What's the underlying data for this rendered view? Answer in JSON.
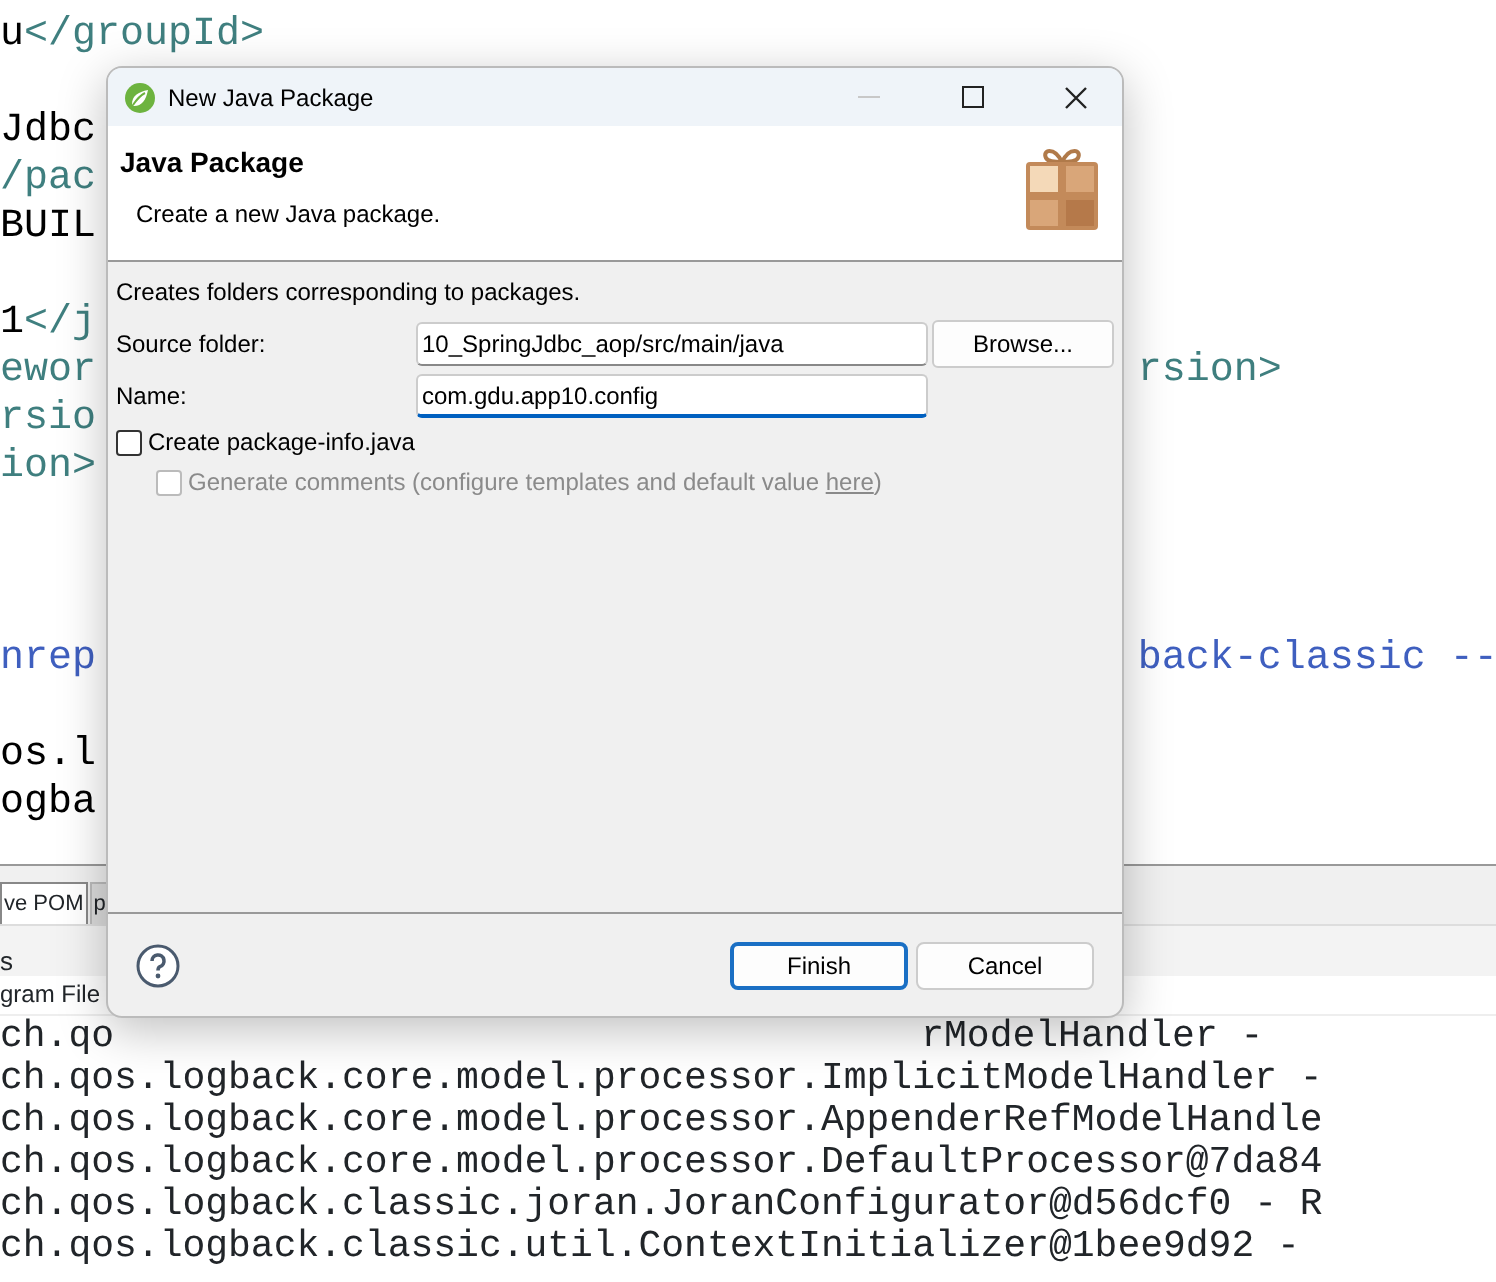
{
  "editor": {
    "lines": [
      {
        "kind": "code",
        "parts": [
          {
            "kind": "text",
            "text": "u"
          },
          {
            "kind": "tag",
            "text": "</groupId>"
          }
        ]
      },
      {
        "kind": "blank"
      },
      {
        "kind": "code",
        "parts": [
          {
            "kind": "text",
            "text": "Jdbc"
          }
        ]
      },
      {
        "kind": "code",
        "parts": [
          {
            "kind": "tag",
            "text": "/pac"
          }
        ]
      },
      {
        "kind": "code",
        "parts": [
          {
            "kind": "text",
            "text": "BUIL"
          }
        ]
      },
      {
        "kind": "blank"
      },
      {
        "kind": "code",
        "parts": [
          {
            "kind": "text",
            "text": "1"
          },
          {
            "kind": "tag",
            "text": "</j"
          }
        ]
      },
      {
        "kind": "code",
        "parts": [
          {
            "kind": "tag",
            "text": "ewor"
          }
        ],
        "right": {
          "kind": "tag",
          "text": "rsion>"
        }
      },
      {
        "kind": "code",
        "parts": [
          {
            "kind": "tag",
            "text": "rsio"
          }
        ]
      },
      {
        "kind": "code",
        "parts": [
          {
            "kind": "tag",
            "text": "ion>"
          }
        ]
      },
      {
        "kind": "blank"
      },
      {
        "kind": "blank"
      },
      {
        "kind": "blank"
      },
      {
        "kind": "code",
        "parts": [
          {
            "kind": "comment",
            "text": "nrep"
          }
        ],
        "right": {
          "kind": "comment",
          "text": "back-classic --"
        }
      },
      {
        "kind": "blank"
      },
      {
        "kind": "code",
        "parts": [
          {
            "kind": "text",
            "text": "os.l"
          }
        ]
      },
      {
        "kind": "code",
        "parts": [
          {
            "kind": "text",
            "text": "ogba"
          }
        ]
      }
    ]
  },
  "editor_tabs": [
    {
      "label": "ve POM",
      "selected": true
    },
    {
      "label": "p",
      "selected": false
    }
  ],
  "console": {
    "tab": "s",
    "header": "gram File",
    "lines": [
      {
        "left": "ch.qo",
        "right": "rModelHandler -"
      },
      {
        "left": "ch.qos.logback.core.model.processor.ImplicitModelHandler -"
      },
      {
        "left": "ch.qos.logback.core.model.processor.AppenderRefModelHandle"
      },
      {
        "left": "ch.qos.logback.core.model.processor.DefaultProcessor@7da84"
      },
      {
        "left": "ch.qos.logback.classic.joran.JoranConfigurator@d56dcf0 - R"
      },
      {
        "left": "ch.qos.logback.classic.util.ContextInitializer@1bee9d92 -"
      }
    ]
  },
  "dialog": {
    "title": "New Java Package",
    "minimize_disabled": true,
    "banner": {
      "title": "Java Package",
      "description": "Create a new Java package."
    },
    "info": "Creates folders corresponding to packages.",
    "fields": [
      {
        "label": "Source folder:",
        "value": "10_SpringJdbc_aop/src/main/java",
        "focused": false,
        "button": "Browse..."
      },
      {
        "label": "Name:",
        "value": "com.gdu.app10.config",
        "focused": true
      }
    ],
    "create_package_info": {
      "label": "Create package-info.java",
      "checked": false
    },
    "generate_comments": {
      "label": "Generate comments (configure templates and default value ",
      "link": "here",
      "suffix": ")",
      "checked": false,
      "disabled": true
    },
    "buttons": [
      {
        "label": "Finish",
        "default": true
      },
      {
        "label": "Cancel",
        "default": false
      }
    ]
  }
}
